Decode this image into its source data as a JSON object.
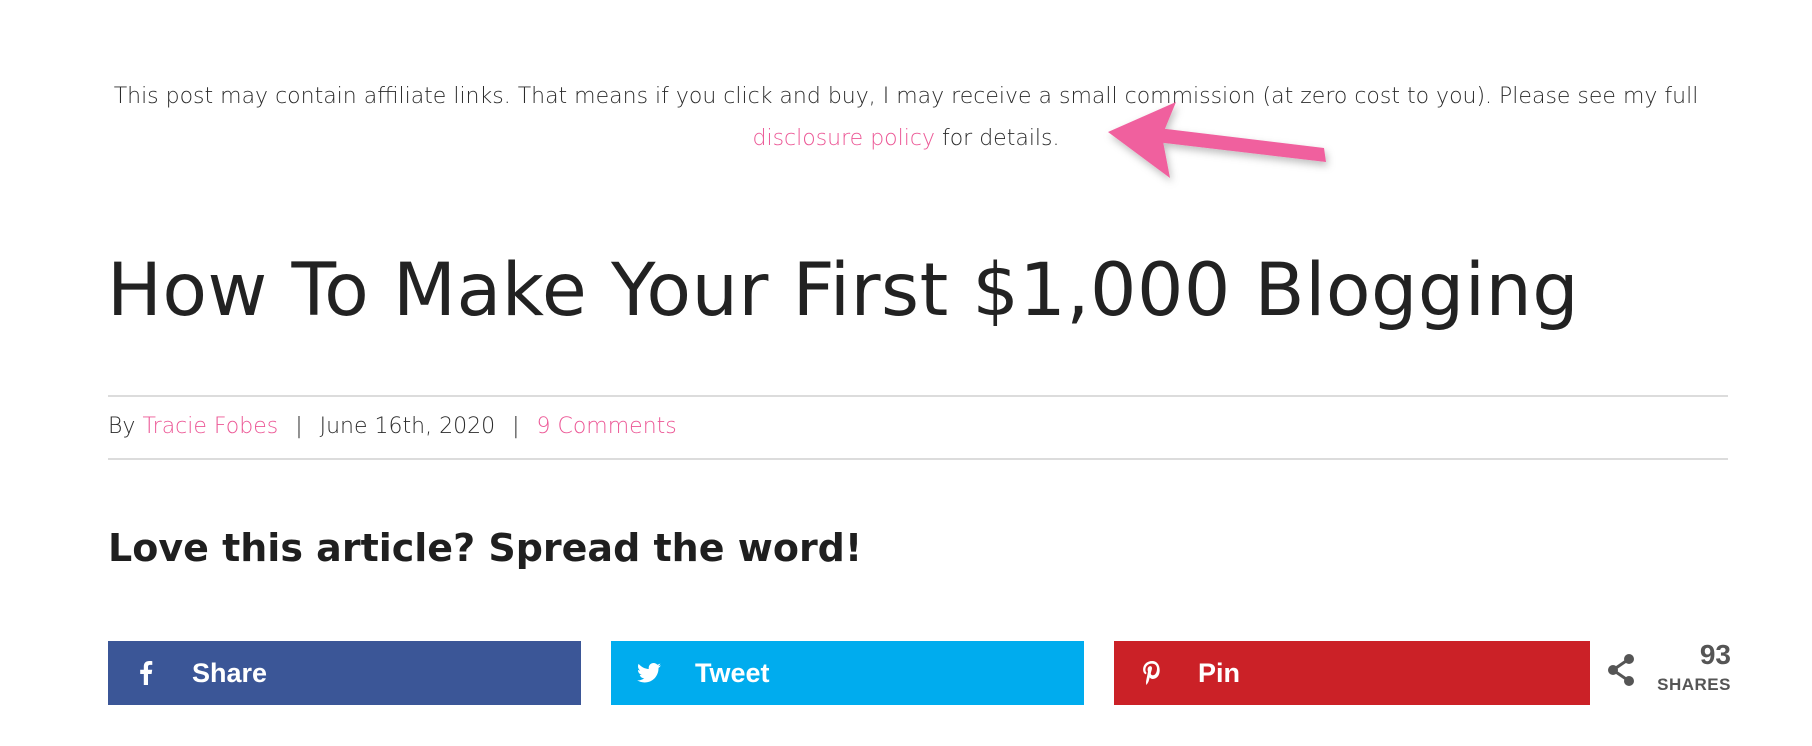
{
  "disclaimer": {
    "text_before": "This post may contain affiliate links. That means if you click and buy, I may receive a small commission (at zero cost to you). Please see my full ",
    "link_text": "disclosure policy",
    "text_after": " for details."
  },
  "article": {
    "title": "How To Make Your First $1,000 Blogging",
    "byline_prefix": "By",
    "author": "Tracie Fobes",
    "separator": "|",
    "date": "June 16th, 2020",
    "comments": "9 Comments"
  },
  "share": {
    "heading": "Love this article? Spread the word!",
    "buttons": [
      {
        "label": "Share",
        "icon": "facebook-icon",
        "color": "#3b5697"
      },
      {
        "label": "Tweet",
        "icon": "twitter-icon",
        "color": "#00acee"
      },
      {
        "label": "Pin",
        "icon": "pinterest-icon",
        "color": "#cb2127"
      }
    ],
    "count": "93",
    "count_label": "SHARES"
  },
  "colors": {
    "link": "#ec5896",
    "annotation_arrow": "#f0609e"
  }
}
